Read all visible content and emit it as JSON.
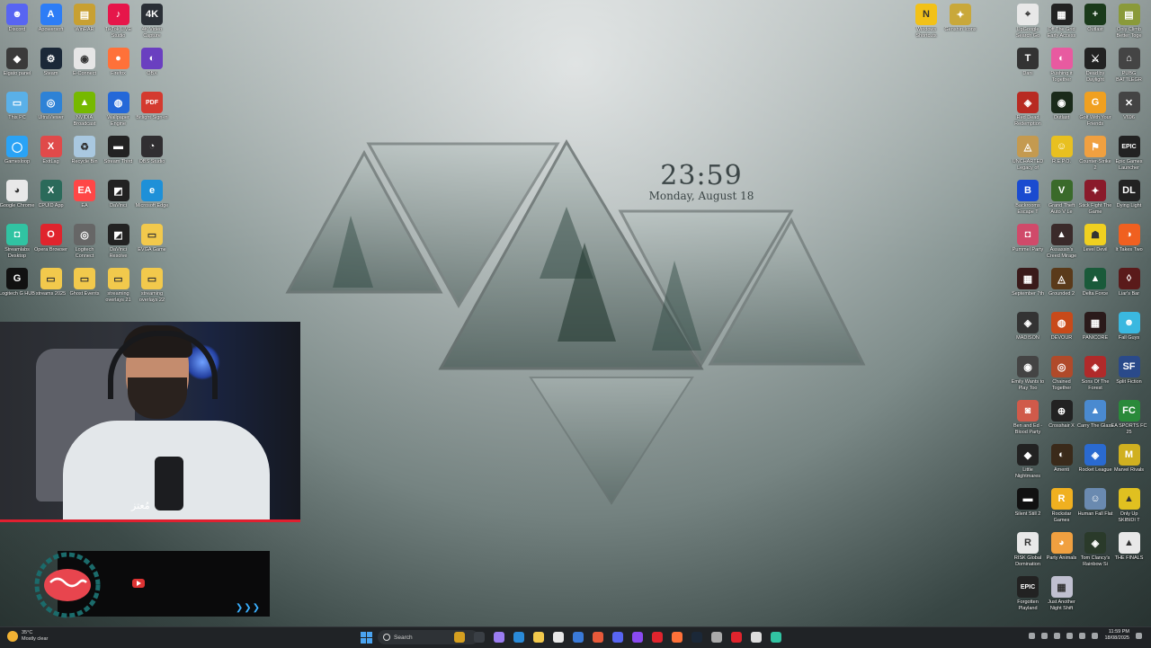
{
  "clock": {
    "time": "23:59",
    "date": "Monday, August 18"
  },
  "left_icons": [
    {
      "label": "Discord",
      "color": "#5865f2",
      "glyph": "☻"
    },
    {
      "label": "Apowersoft",
      "color": "#2d7df6",
      "glyph": "A"
    },
    {
      "label": "WinRAR",
      "color": "#c8a032",
      "glyph": "▤"
    },
    {
      "label": "TikTok LIVE Studio",
      "color": "#e6164a",
      "glyph": "♪"
    },
    {
      "label": "4K Video Capture",
      "color": "#2a2f36",
      "glyph": "4K"
    },
    {
      "label": "Elgato panel",
      "color": "#3a3a3a",
      "glyph": "◆"
    },
    {
      "label": "Steam",
      "color": "#1b2838",
      "glyph": "⚙"
    },
    {
      "label": "E-Connect",
      "color": "#e6e6e6",
      "glyph": "◉"
    },
    {
      "label": "Firefox",
      "color": "#ff7139",
      "glyph": "●"
    },
    {
      "label": "OBX",
      "color": "#6a3fc0",
      "glyph": "◐"
    },
    {
      "label": "This PC",
      "color": "#5ab0e8",
      "glyph": "▭"
    },
    {
      "label": "UltraViewer",
      "color": "#2e82d6",
      "glyph": "◎"
    },
    {
      "label": "NVIDIA Broadcast",
      "color": "#76b900",
      "glyph": "▲"
    },
    {
      "label": "Wallpaper Engine",
      "color": "#2468d8",
      "glyph": "◍"
    },
    {
      "label": "Bitlight Sign-in",
      "color": "#d43a2f",
      "glyph": "PDF"
    },
    {
      "label": "Gamesloop",
      "color": "#2aa3f6",
      "glyph": "◯"
    },
    {
      "label": "ExitLag",
      "color": "#e04a4a",
      "glyph": "X"
    },
    {
      "label": "Recycle Bin",
      "color": "#a9c8e0",
      "glyph": "♻"
    },
    {
      "label": "Stream Third",
      "color": "#222",
      "glyph": "▬"
    },
    {
      "label": "OBS Studio",
      "color": "#302e31",
      "glyph": "◔"
    },
    {
      "label": "Google Chrome",
      "color": "#e8e8e8",
      "glyph": "◕"
    },
    {
      "label": "CPUID App",
      "color": "#2b6a5a",
      "glyph": "X"
    },
    {
      "label": "EA",
      "color": "#ff4747",
      "glyph": "EA"
    },
    {
      "label": "DaVinci",
      "color": "#222",
      "glyph": "◩"
    },
    {
      "label": "Microsoft Edge",
      "color": "#1e90d8",
      "glyph": "e"
    },
    {
      "label": "Streamlabs Desktop",
      "color": "#31c3a2",
      "glyph": "◘"
    },
    {
      "label": "Opera Browser",
      "color": "#e0242d",
      "glyph": "O"
    },
    {
      "label": "Logitech Connect",
      "color": "#666",
      "glyph": "◎"
    },
    {
      "label": "DaVinci Resolve",
      "color": "#222",
      "glyph": "◩"
    },
    {
      "label": "EVGA Game",
      "color": "#f2c94c",
      "glyph": "▭"
    },
    {
      "label": "Logitech G HUB",
      "color": "#111",
      "glyph": "G"
    },
    {
      "label": "streams 2025",
      "color": "#f2c94c",
      "glyph": "▭"
    },
    {
      "label": "Ghost Events",
      "color": "#f2c94c",
      "glyph": "▭"
    },
    {
      "label": "streaming overlays 21",
      "color": "#f2c94c",
      "glyph": "▭"
    },
    {
      "label": "streaming overlays 22",
      "color": "#f2c94c",
      "glyph": "▭"
    }
  ],
  "top_mid_icons": [
    {
      "label": "Windows Shortcuts",
      "color": "#f2c118",
      "glyph": "N"
    },
    {
      "label": "Genshin Icons",
      "color": "#c9a83a",
      "glyph": "✦"
    }
  ],
  "right_icons": [
    {
      "label": "UpGoogle Search Go",
      "color": "#e8e8e8",
      "glyph": "⌖"
    },
    {
      "label": "Off The Grid Early Access",
      "color": "#222",
      "glyph": "▦"
    },
    {
      "label": "Outlast",
      "color": "#1a3a1a",
      "glyph": "+"
    },
    {
      "label": "Only Climb Better Toge",
      "color": "#8a9a3a",
      "glyph": "▤"
    },
    {
      "label": "Dani",
      "color": "#333",
      "glyph": "T"
    },
    {
      "label": "Pushing it Together",
      "color": "#e85aa0",
      "glyph": "◐"
    },
    {
      "label": "Dead by Daylight",
      "color": "#222",
      "glyph": "⚔"
    },
    {
      "label": "PUBG BATTLEGR",
      "color": "#444",
      "glyph": "⌂"
    },
    {
      "label": "Red Dead Redemption",
      "color": "#b82a22",
      "glyph": "◈"
    },
    {
      "label": "Outlast",
      "color": "#1a2a1a",
      "glyph": "◉"
    },
    {
      "label": "Golf With Your Friends",
      "color": "#f0a020",
      "glyph": "G"
    },
    {
      "label": "V696",
      "color": "#444",
      "glyph": "✕"
    },
    {
      "label": "UNCHARTED Legacy of",
      "color": "#c49a50",
      "glyph": "◬"
    },
    {
      "label": "R.E.P.O.",
      "color": "#e8c020",
      "glyph": "☺"
    },
    {
      "label": "Counter-Strike 2",
      "color": "#f0a040",
      "glyph": "⚑"
    },
    {
      "label": "Epic Games Launcher",
      "color": "#222",
      "glyph": "EPIC"
    },
    {
      "label": "Backrooms Escape T",
      "color": "#1a4bd0",
      "glyph": "B"
    },
    {
      "label": "Grand Theft Auto V Le",
      "color": "#3a6a2a",
      "glyph": "V"
    },
    {
      "label": "Stick Fight The Game",
      "color": "#8a1a2a",
      "glyph": "✦"
    },
    {
      "label": "Dying Light",
      "color": "#222",
      "glyph": "DL"
    },
    {
      "label": "Pummel Party",
      "color": "#d04a6a",
      "glyph": "◘"
    },
    {
      "label": "Assassin's Creed Mirage",
      "color": "#3a2a2a",
      "glyph": "▲"
    },
    {
      "label": "Level Devil",
      "color": "#f0d020",
      "glyph": "☗"
    },
    {
      "label": "It Takes Two",
      "color": "#f06020",
      "glyph": "◑"
    },
    {
      "label": "September 7th",
      "color": "#3a1a1a",
      "glyph": "▦"
    },
    {
      "label": "Grounded 2",
      "color": "#5a3a1a",
      "glyph": "◬"
    },
    {
      "label": "Delta Force",
      "color": "#1a5a3a",
      "glyph": "▲"
    },
    {
      "label": "Liar's Bar",
      "color": "#5a1a1a",
      "glyph": "◊"
    },
    {
      "label": "MADISON",
      "color": "#333",
      "glyph": "◈"
    },
    {
      "label": "DEVOUR",
      "color": "#c84a1a",
      "glyph": "◍"
    },
    {
      "label": "PANICORE",
      "color": "#2a1a1a",
      "glyph": "▦"
    },
    {
      "label": "Fall Guys",
      "color": "#3ab8e0",
      "glyph": "☻"
    },
    {
      "label": "Emily Wants to Play Too",
      "color": "#444",
      "glyph": "◉"
    },
    {
      "label": "Chained Together",
      "color": "#b04a2a",
      "glyph": "◎"
    },
    {
      "label": "Sons Of The Forest",
      "color": "#b02a2a",
      "glyph": "◈"
    },
    {
      "label": "Split Fiction",
      "color": "#2a4a8a",
      "glyph": "SF"
    },
    {
      "label": "Ben and Ed - Blood Party",
      "color": "#d05a4a",
      "glyph": "◙"
    },
    {
      "label": "Crosshair X",
      "color": "#222",
      "glyph": "⊕"
    },
    {
      "label": "Carry The Glass",
      "color": "#4a8ad0",
      "glyph": "▲"
    },
    {
      "label": "EA SPORTS FC 25",
      "color": "#2a8a3a",
      "glyph": "FC"
    },
    {
      "label": "Little Nightmares",
      "color": "#222",
      "glyph": "◆"
    },
    {
      "label": "Amenti",
      "color": "#3a2a1a",
      "glyph": "◐"
    },
    {
      "label": "Rocket League",
      "color": "#2a6ad0",
      "glyph": "◈"
    },
    {
      "label": "Marvel Rivals",
      "color": "#d0b020",
      "glyph": "M"
    },
    {
      "label": "Silent Still 2",
      "color": "#111",
      "glyph": "▬"
    },
    {
      "label": "Rockstar Games",
      "color": "#f0b020",
      "glyph": "R"
    },
    {
      "label": "Human Fall Flat",
      "color": "#6a8ab0",
      "glyph": "☺"
    },
    {
      "label": "Only Up SKIBIDI T",
      "color": "#e0c020",
      "glyph": "▲"
    },
    {
      "label": "RISK Global Domination",
      "color": "#e8e8e8",
      "glyph": "R"
    },
    {
      "label": "Party Animals",
      "color": "#f0a040",
      "glyph": "◕"
    },
    {
      "label": "Tom Clancy's Rainbow Si",
      "color": "#2a3a2a",
      "glyph": "◈"
    },
    {
      "label": "THE FINALS",
      "color": "#e8e8e8",
      "glyph": "▲"
    },
    {
      "label": "Forgotten Playland",
      "color": "#222",
      "glyph": "EPIC"
    },
    {
      "label": "Just Another Night Shift",
      "color": "#c0c0d0",
      "glyph": "▦"
    }
  ],
  "webcam": {
    "signature": "مُعتز"
  },
  "taskbar": {
    "weather_temp": "35°C",
    "weather_desc": "Mostly clear",
    "search_placeholder": "Search",
    "time": "11:59 PM",
    "date": "18/08/2025",
    "apps": [
      "#d6a020",
      "#3a3f45",
      "#9a7cf0",
      "#2a8ad8",
      "#f2c94c",
      "#e8e8e8",
      "#3a7ad8",
      "#e85a3a",
      "#5865f2",
      "#8a4af0",
      "#e0242d",
      "#ff7139",
      "#1b2838",
      "#aaa",
      "#e0242d",
      "#ddd",
      "#31c3a2"
    ]
  }
}
